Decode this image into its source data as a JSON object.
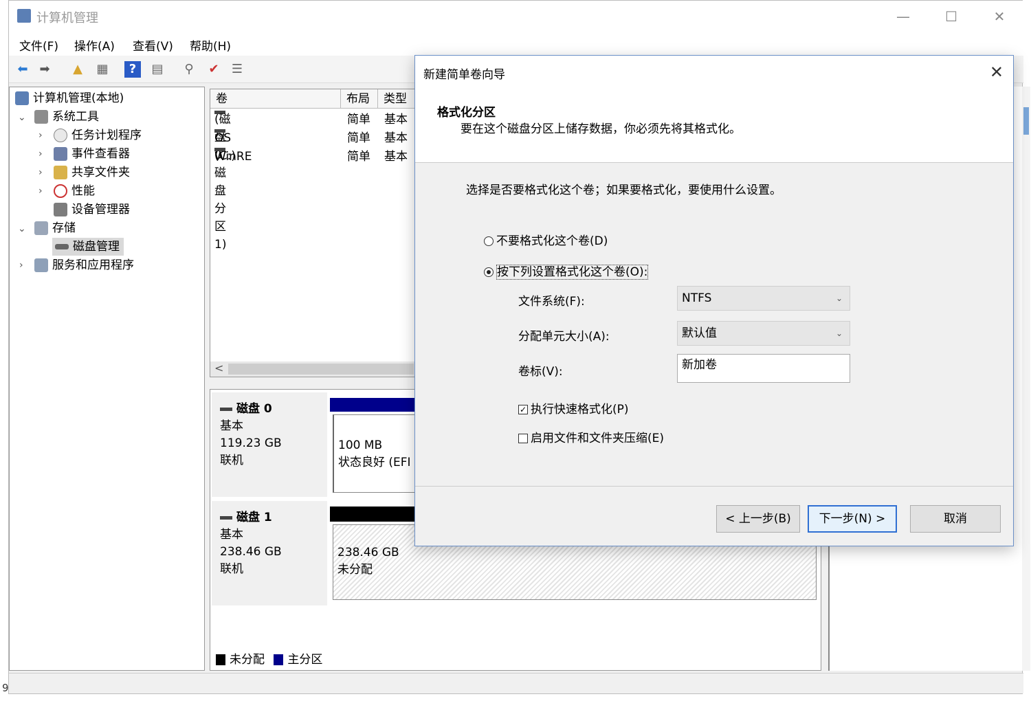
{
  "window": {
    "title": "计算机管理",
    "controls": {
      "minimize": "—",
      "maximize": "☐",
      "close": "✕"
    }
  },
  "menu": [
    "文件(F)",
    "操作(A)",
    "查看(V)",
    "帮助(H)"
  ],
  "tree": {
    "root": "计算机管理(本地)",
    "system_tools": "系统工具",
    "task_scheduler": "任务计划程序",
    "event_viewer": "事件查看器",
    "shared_folders": "共享文件夹",
    "performance": "性能",
    "device_manager": "设备管理器",
    "storage": "存储",
    "disk_management": "磁盘管理",
    "services": "服务和应用程序"
  },
  "volume_list": {
    "headers": {
      "volume": "卷",
      "layout": "布局",
      "type": "类型"
    },
    "rows": [
      {
        "volume": "(磁盘 0 磁盘分区 1)",
        "layout": "简单",
        "type": "基本"
      },
      {
        "volume": "OS (C:)",
        "layout": "简单",
        "type": "基本"
      },
      {
        "volume": "WinRE",
        "layout": "简单",
        "type": "基本"
      }
    ],
    "scroll_left": "<"
  },
  "disks": [
    {
      "name": "磁盘 0",
      "kind": "基本",
      "size": "119.23 GB",
      "status": "联机",
      "partition": {
        "size": "100 MB",
        "state": "状态良好 (EFI"
      }
    },
    {
      "name": "磁盘 1",
      "kind": "基本",
      "size": "238.46 GB",
      "status": "联机",
      "partition": {
        "size": "238.46 GB",
        "state": "未分配"
      }
    }
  ],
  "legend": {
    "unallocated": "未分配",
    "primary": "主分区"
  },
  "colors": {
    "primary": "#00008b",
    "unallocated": "#000000",
    "accent": "#2f6fd2"
  },
  "status_left": "9",
  "dialog": {
    "title": "新建简单卷向导",
    "close": "✕",
    "heading": "格式化分区",
    "subheading": "要在这个磁盘分区上储存数据，你必须先将其格式化。",
    "prompt": "选择是否要格式化这个卷；如果要格式化，要使用什么设置。",
    "radio_no_format": "不要格式化这个卷(D)",
    "radio_format": "按下列设置格式化这个卷(O):",
    "fs_label": "文件系统(F):",
    "fs_value": "NTFS",
    "alloc_label": "分配单元大小(A):",
    "alloc_value": "默认值",
    "vol_label": "卷标(V):",
    "vol_value": "新加卷",
    "quick_format": "执行快速格式化(P)",
    "quick_format_checked": true,
    "compression": "启用文件和文件夹压缩(E)",
    "compression_checked": false,
    "btn_back": "< 上一步(B)",
    "btn_next": "下一步(N) >",
    "btn_cancel": "取消"
  }
}
